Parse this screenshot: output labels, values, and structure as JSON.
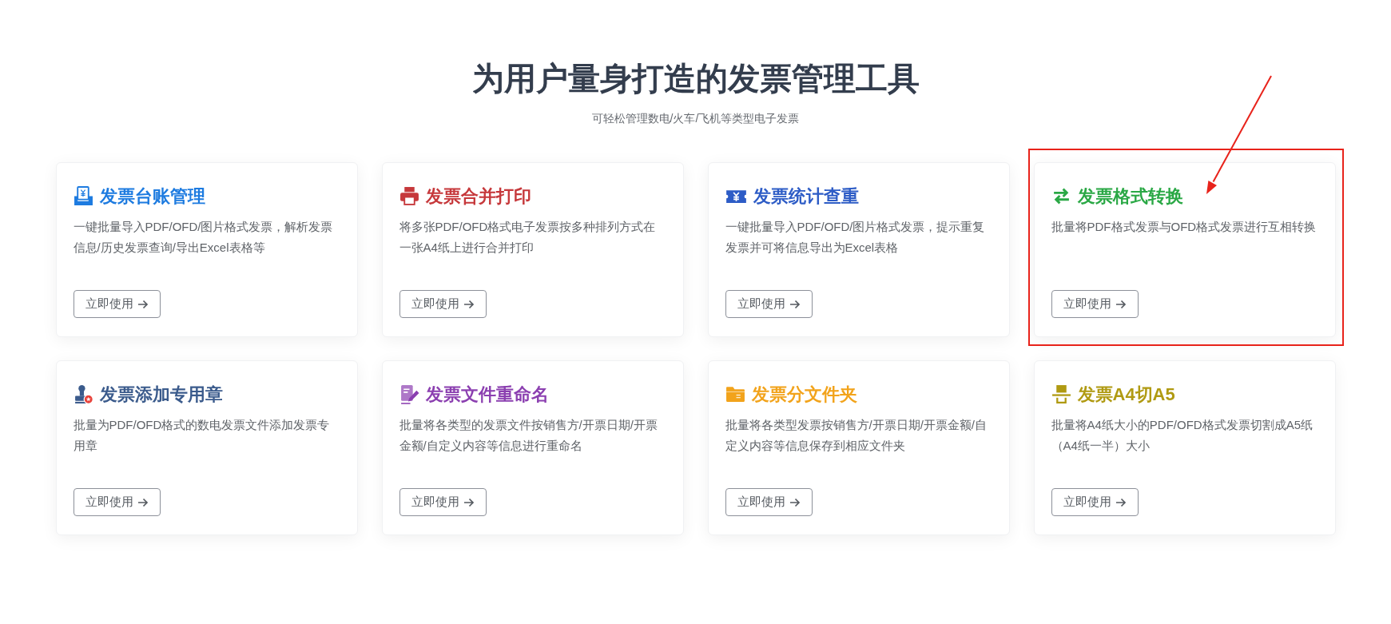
{
  "header": {
    "title": "为用户量身打造的发票管理工具",
    "subtitle": "可轻松管理数电/火车/飞机等类型电子发票"
  },
  "cards": [
    {
      "kind": "ledger",
      "title": "发票台账管理",
      "color": "#1d7be0",
      "description": "一键批量导入PDF/OFD/图片格式发票，解析发票信息/历史发票查询/导出Excel表格等",
      "button": "立即使用",
      "highlighted": false
    },
    {
      "kind": "print",
      "title": "发票合并打印",
      "color": "#c6383b",
      "description": "将多张PDF/OFD格式电子发票按多种排列方式在一张A4纸上进行合并打印",
      "button": "立即使用",
      "highlighted": false
    },
    {
      "kind": "stats",
      "title": "发票统计查重",
      "color": "#2d5cc6",
      "description": "一键批量导入PDF/OFD/图片格式发票，提示重复发票并可将信息导出为Excel表格",
      "button": "立即使用",
      "highlighted": false
    },
    {
      "kind": "convert",
      "title": "发票格式转换",
      "color": "#2aa845",
      "description": "批量将PDF格式发票与OFD格式发票进行互相转换",
      "button": "立即使用",
      "highlighted": true
    },
    {
      "kind": "stamp",
      "title": "发票添加专用章",
      "color": "#3b5b8c",
      "description": "批量为PDF/OFD格式的数电发票文件添加发票专用章",
      "button": "立即使用",
      "highlighted": false
    },
    {
      "kind": "rename",
      "title": "发票文件重命名",
      "color": "#8b3fb0",
      "description": "批量将各类型的发票文件按销售方/开票日期/开票金额/自定义内容等信息进行重命名",
      "button": "立即使用",
      "highlighted": false
    },
    {
      "kind": "folder",
      "title": "发票分文件夹",
      "color": "#f2a31b",
      "description": "批量将各类型发票按销售方/开票日期/开票金额/自定义内容等信息保存到相应文件夹",
      "button": "立即使用",
      "highlighted": false
    },
    {
      "kind": "split",
      "title": "发票A4切A5",
      "color": "#b09a12",
      "description": "批量将A4纸大小的PDF/OFD格式发票切割成A5纸（A4纸一半）大小",
      "button": "立即使用",
      "highlighted": false
    }
  ]
}
